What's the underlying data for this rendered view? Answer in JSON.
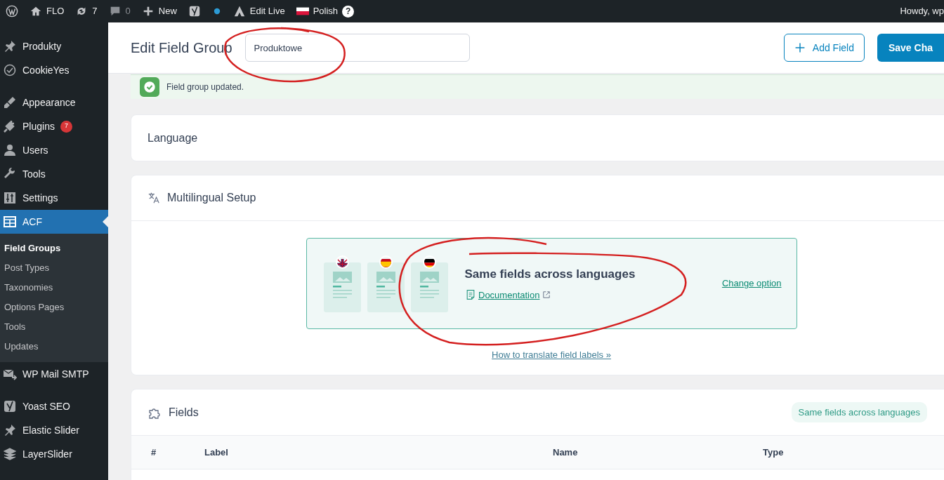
{
  "admin_bar": {
    "links": [
      {
        "label": "FLO"
      },
      {
        "label": "7"
      },
      {
        "label": "0"
      },
      {
        "label": "New"
      },
      {
        "label": "Edit Live"
      },
      {
        "label": "Polish"
      }
    ],
    "help_mark": "?",
    "greeting": "Howdy, wp"
  },
  "sidebar": {
    "groups": [
      [
        {
          "label": "Produkty",
          "selected": false
        },
        {
          "label": "CookieYes",
          "selected": false
        }
      ],
      [
        {
          "label": "Appearance",
          "selected": false
        },
        {
          "label": "Plugins",
          "badge": "7",
          "selected": false
        },
        {
          "label": "Users",
          "selected": false
        },
        {
          "label": "Tools",
          "selected": false
        },
        {
          "label": "Settings",
          "selected": false
        },
        {
          "label": "ACF",
          "selected": true,
          "children": [
            {
              "label": "Field Groups",
              "selected": true
            },
            {
              "label": "Post Types",
              "selected": false
            },
            {
              "label": "Taxonomies",
              "selected": false
            },
            {
              "label": "Options Pages",
              "selected": false
            },
            {
              "label": "Tools",
              "selected": false
            },
            {
              "label": "Updates",
              "selected": false
            }
          ]
        },
        {
          "label": "WP Mail SMTP",
          "selected": false
        }
      ],
      [
        {
          "label": "Yoast SEO",
          "selected": false
        },
        {
          "label": "Elastic Slider",
          "selected": false
        },
        {
          "label": "LayerSlider",
          "selected": false
        }
      ]
    ]
  },
  "header": {
    "title": "Edit Field Group",
    "title_field": {
      "value": "Produktowe"
    },
    "buttons": [
      {
        "kind": "outline",
        "label": "Add Field"
      },
      {
        "kind": "primary",
        "label": "Save Cha"
      }
    ]
  },
  "notice": {
    "text": "Field group updated."
  },
  "language_card": {
    "title": "Language"
  },
  "multilingual_card": {
    "title": "Multilingual Setup",
    "option": {
      "title": "Same fields across languages",
      "doc_link": "Documentation",
      "change_link": "Change option"
    },
    "help_link": "How to translate field labels »"
  },
  "fields_card": {
    "title": "Fields",
    "pill": "Same fields across languages",
    "table": {
      "columns": [
        "#",
        "Label",
        "Name",
        "Type"
      ]
    }
  }
}
